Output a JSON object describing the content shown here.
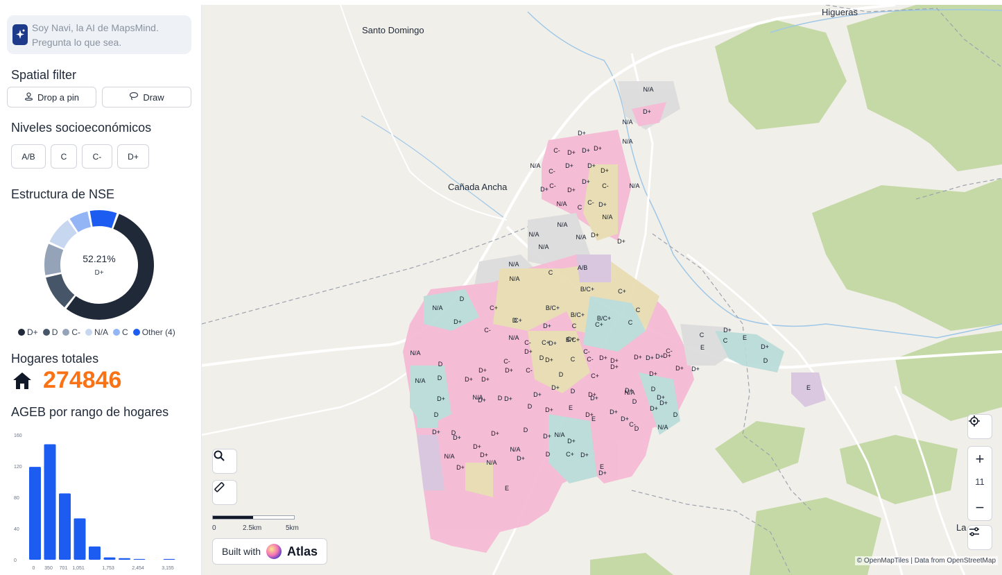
{
  "assistant": {
    "placeholder": "Soy Navi, la AI de MapsMind. Pregunta lo que sea."
  },
  "spatial_filter": {
    "title": "Spatial filter",
    "drop_pin": "Drop a pin",
    "draw": "Draw"
  },
  "niveles": {
    "title": "Niveles socioeconómicos",
    "chips": [
      "A/B",
      "C",
      "C-",
      "D+"
    ]
  },
  "estructura": {
    "title": "Estructura de NSE",
    "center_value": "52.21%",
    "center_label": "D+",
    "segments": [
      {
        "label": "D+",
        "value": 52.21,
        "color": "#1f2937"
      },
      {
        "label": "D",
        "value": 10.5,
        "color": "#475569"
      },
      {
        "label": "C-",
        "value": 9.5,
        "color": "#94a3b8"
      },
      {
        "label": "N/A",
        "value": 8.5,
        "color": "#c7d7f0"
      },
      {
        "label": "C",
        "value": 6.0,
        "color": "#93b4f5"
      },
      {
        "label": "Other (4)",
        "value": 8.2,
        "color": "#1d5cf0"
      }
    ]
  },
  "hogares": {
    "title": "Hogares totales",
    "value": "274846"
  },
  "ageb": {
    "title": "AGEB por rango de hogares"
  },
  "chart_data": {
    "type": "bar",
    "title": "AGEB por rango de hogares",
    "categories": [
      "0",
      "350",
      "701",
      "1,051",
      "",
      "1,753",
      "",
      "2,454",
      "",
      "3,155"
    ],
    "values": [
      119,
      148,
      85,
      53,
      17,
      3,
      2,
      1,
      0,
      1
    ],
    "y_ticks": [
      "0",
      "40",
      "80",
      "120",
      "160"
    ],
    "ylim": [
      0,
      160
    ],
    "color": "#1d5cf0"
  },
  "map": {
    "places": [
      "Higueras",
      "Santo Domingo",
      "Cañada Ancha",
      "La"
    ],
    "zoom": "11",
    "scale_labels": [
      "0",
      "2.5km",
      "5km"
    ],
    "attribution": "© OpenMapTiles | Data from OpenStreetMap",
    "built_with": "Built with",
    "brand": "Atlas",
    "area_labels": [
      "N/A",
      "D+",
      "N/A",
      "D+",
      "N/A",
      "C-",
      "D+",
      "D+",
      "D+",
      "N/A",
      "C-",
      "D+",
      "D+",
      "C-",
      "D+",
      "D+",
      "C-",
      "D+",
      "N/A",
      "D+",
      "N/A",
      "C",
      "C-",
      "D+",
      "N/A",
      "N/A",
      "D+",
      "N/A",
      "N/A",
      "N/A",
      "D+",
      "N/A",
      "A/B",
      "C",
      "B/C+",
      "N/A",
      "D",
      "C+",
      "C+",
      "B/C+",
      "B/C+",
      "C",
      "N/A",
      "C+",
      "D+",
      "B/C+",
      "D",
      "C",
      "D+",
      "C+",
      "C-",
      "C",
      "D+",
      "N/A",
      "C+",
      "C",
      "E",
      "C-",
      "D+",
      "C+",
      "B/C+",
      "E",
      "D+",
      "D",
      "E",
      "N/A",
      "D",
      "C-",
      "D+",
      "C-",
      "D",
      "C-",
      "D+",
      "C",
      "D+",
      "D+",
      "D",
      "N/A",
      "D",
      "D+",
      "D+",
      "C",
      "C-",
      "D+",
      "D+",
      "D+",
      "D+",
      "D+",
      "D+",
      "C-",
      "D+",
      "D+",
      "D+",
      "C+",
      "D+",
      "D",
      "N/A",
      "D",
      "D+",
      "D+",
      "D+",
      "D+",
      "D+",
      "D+",
      "D+",
      "N/A",
      "D",
      "D+",
      "D+",
      "D+",
      "D",
      "D+",
      "D+",
      "D",
      "D",
      "E",
      "D+",
      "D+",
      "D+",
      "C-",
      "D+",
      "D",
      "D",
      "D+",
      "D+",
      "D",
      "D",
      "N/A",
      "D+",
      "D+",
      "N/A",
      "D+",
      "N/A",
      "D+",
      "N/A",
      "C+",
      "D+",
      "E",
      "N/A",
      "D+",
      "D",
      "D+",
      "D+",
      "E",
      "E"
    ]
  }
}
